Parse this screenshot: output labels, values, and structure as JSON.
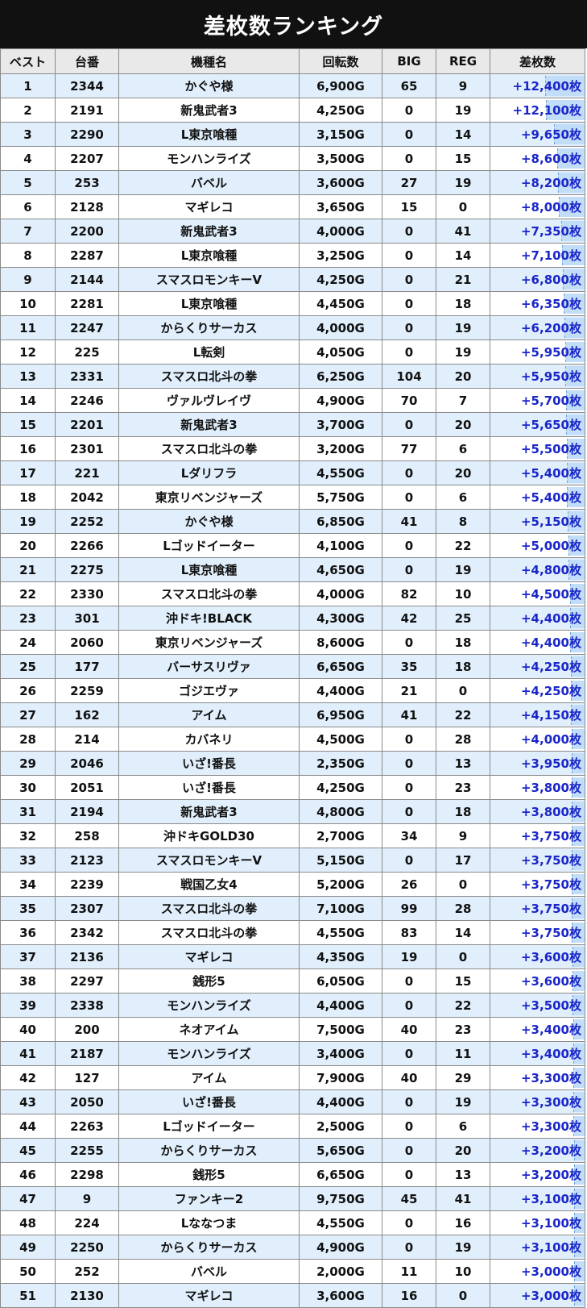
{
  "title": "差枚数ランキング",
  "headers": {
    "rank": "ベスト",
    "machine_no": "台番",
    "model": "機種名",
    "spins": "回転数",
    "big": "BIG",
    "reg": "REG",
    "diff": "差枚数"
  },
  "rows": [
    {
      "rank": "1",
      "machine_no": "2344",
      "model": "かぐや様",
      "spins": "6,900G",
      "big": "65",
      "reg": "9",
      "diff": "+12,400枚",
      "diff_value": 12400
    },
    {
      "rank": "2",
      "machine_no": "2191",
      "model": "新鬼武者3",
      "spins": "4,250G",
      "big": "0",
      "reg": "19",
      "diff": "+12,100枚",
      "diff_value": 12100
    },
    {
      "rank": "3",
      "machine_no": "2290",
      "model": "L東京喰種",
      "spins": "3,150G",
      "big": "0",
      "reg": "14",
      "diff": "+9,650枚",
      "diff_value": 9650
    },
    {
      "rank": "4",
      "machine_no": "2207",
      "model": "モンハンライズ",
      "spins": "3,500G",
      "big": "0",
      "reg": "15",
      "diff": "+8,600枚",
      "diff_value": 8600
    },
    {
      "rank": "5",
      "machine_no": "253",
      "model": "バベル",
      "spins": "3,600G",
      "big": "27",
      "reg": "19",
      "diff": "+8,200枚",
      "diff_value": 8200
    },
    {
      "rank": "6",
      "machine_no": "2128",
      "model": "マギレコ",
      "spins": "3,650G",
      "big": "15",
      "reg": "0",
      "diff": "+8,000枚",
      "diff_value": 8000
    },
    {
      "rank": "7",
      "machine_no": "2200",
      "model": "新鬼武者3",
      "spins": "4,000G",
      "big": "0",
      "reg": "41",
      "diff": "+7,350枚",
      "diff_value": 7350
    },
    {
      "rank": "8",
      "machine_no": "2287",
      "model": "L東京喰種",
      "spins": "3,250G",
      "big": "0",
      "reg": "14",
      "diff": "+7,100枚",
      "diff_value": 7100
    },
    {
      "rank": "9",
      "machine_no": "2144",
      "model": "スマスロモンキーV",
      "spins": "4,250G",
      "big": "0",
      "reg": "21",
      "diff": "+6,800枚",
      "diff_value": 6800
    },
    {
      "rank": "10",
      "machine_no": "2281",
      "model": "L東京喰種",
      "spins": "4,450G",
      "big": "0",
      "reg": "18",
      "diff": "+6,350枚",
      "diff_value": 6350
    },
    {
      "rank": "11",
      "machine_no": "2247",
      "model": "からくりサーカス",
      "spins": "4,000G",
      "big": "0",
      "reg": "19",
      "diff": "+6,200枚",
      "diff_value": 6200
    },
    {
      "rank": "12",
      "machine_no": "225",
      "model": "L転剣",
      "spins": "4,050G",
      "big": "0",
      "reg": "19",
      "diff": "+5,950枚",
      "diff_value": 5950
    },
    {
      "rank": "13",
      "machine_no": "2331",
      "model": "スマスロ北斗の拳",
      "spins": "6,250G",
      "big": "104",
      "reg": "20",
      "diff": "+5,950枚",
      "diff_value": 5950
    },
    {
      "rank": "14",
      "machine_no": "2246",
      "model": "ヴァルヴレイヴ",
      "spins": "4,900G",
      "big": "70",
      "reg": "7",
      "diff": "+5,700枚",
      "diff_value": 5700
    },
    {
      "rank": "15",
      "machine_no": "2201",
      "model": "新鬼武者3",
      "spins": "3,700G",
      "big": "0",
      "reg": "20",
      "diff": "+5,650枚",
      "diff_value": 5650
    },
    {
      "rank": "16",
      "machine_no": "2301",
      "model": "スマスロ北斗の拳",
      "spins": "3,200G",
      "big": "77",
      "reg": "6",
      "diff": "+5,500枚",
      "diff_value": 5500
    },
    {
      "rank": "17",
      "machine_no": "221",
      "model": "Lダリフラ",
      "spins": "4,550G",
      "big": "0",
      "reg": "20",
      "diff": "+5,400枚",
      "diff_value": 5400
    },
    {
      "rank": "18",
      "machine_no": "2042",
      "model": "東京リベンジャーズ",
      "spins": "5,750G",
      "big": "0",
      "reg": "6",
      "diff": "+5,400枚",
      "diff_value": 5400
    },
    {
      "rank": "19",
      "machine_no": "2252",
      "model": "かぐや様",
      "spins": "6,850G",
      "big": "41",
      "reg": "8",
      "diff": "+5,150枚",
      "diff_value": 5150
    },
    {
      "rank": "20",
      "machine_no": "2266",
      "model": "Lゴッドイーター",
      "spins": "4,100G",
      "big": "0",
      "reg": "22",
      "diff": "+5,000枚",
      "diff_value": 5000
    },
    {
      "rank": "21",
      "machine_no": "2275",
      "model": "L東京喰種",
      "spins": "4,650G",
      "big": "0",
      "reg": "19",
      "diff": "+4,800枚",
      "diff_value": 4800
    },
    {
      "rank": "22",
      "machine_no": "2330",
      "model": "スマスロ北斗の拳",
      "spins": "4,000G",
      "big": "82",
      "reg": "10",
      "diff": "+4,500枚",
      "diff_value": 4500
    },
    {
      "rank": "23",
      "machine_no": "301",
      "model": "沖ドキ!BLACK",
      "spins": "4,300G",
      "big": "42",
      "reg": "25",
      "diff": "+4,400枚",
      "diff_value": 4400
    },
    {
      "rank": "24",
      "machine_no": "2060",
      "model": "東京リベンジャーズ",
      "spins": "8,600G",
      "big": "0",
      "reg": "18",
      "diff": "+4,400枚",
      "diff_value": 4400
    },
    {
      "rank": "25",
      "machine_no": "177",
      "model": "バーサスリヴァ",
      "spins": "6,650G",
      "big": "35",
      "reg": "18",
      "diff": "+4,250枚",
      "diff_value": 4250
    },
    {
      "rank": "26",
      "machine_no": "2259",
      "model": "ゴジエヴァ",
      "spins": "4,400G",
      "big": "21",
      "reg": "0",
      "diff": "+4,250枚",
      "diff_value": 4250
    },
    {
      "rank": "27",
      "machine_no": "162",
      "model": "アイム",
      "spins": "6,950G",
      "big": "41",
      "reg": "22",
      "diff": "+4,150枚",
      "diff_value": 4150
    },
    {
      "rank": "28",
      "machine_no": "214",
      "model": "カバネリ",
      "spins": "4,500G",
      "big": "0",
      "reg": "28",
      "diff": "+4,000枚",
      "diff_value": 4000
    },
    {
      "rank": "29",
      "machine_no": "2046",
      "model": "いざ!番長",
      "spins": "2,350G",
      "big": "0",
      "reg": "13",
      "diff": "+3,950枚",
      "diff_value": 3950
    },
    {
      "rank": "30",
      "machine_no": "2051",
      "model": "いざ!番長",
      "spins": "4,250G",
      "big": "0",
      "reg": "23",
      "diff": "+3,800枚",
      "diff_value": 3800
    },
    {
      "rank": "31",
      "machine_no": "2194",
      "model": "新鬼武者3",
      "spins": "4,800G",
      "big": "0",
      "reg": "18",
      "diff": "+3,800枚",
      "diff_value": 3800
    },
    {
      "rank": "32",
      "machine_no": "258",
      "model": "沖ドキGOLD30",
      "spins": "2,700G",
      "big": "34",
      "reg": "9",
      "diff": "+3,750枚",
      "diff_value": 3750
    },
    {
      "rank": "33",
      "machine_no": "2123",
      "model": "スマスロモンキーV",
      "spins": "5,150G",
      "big": "0",
      "reg": "17",
      "diff": "+3,750枚",
      "diff_value": 3750
    },
    {
      "rank": "34",
      "machine_no": "2239",
      "model": "戦国乙女4",
      "spins": "5,200G",
      "big": "26",
      "reg": "0",
      "diff": "+3,750枚",
      "diff_value": 3750
    },
    {
      "rank": "35",
      "machine_no": "2307",
      "model": "スマスロ北斗の拳",
      "spins": "7,100G",
      "big": "99",
      "reg": "28",
      "diff": "+3,750枚",
      "diff_value": 3750
    },
    {
      "rank": "36",
      "machine_no": "2342",
      "model": "スマスロ北斗の拳",
      "spins": "4,550G",
      "big": "83",
      "reg": "14",
      "diff": "+3,750枚",
      "diff_value": 3750
    },
    {
      "rank": "37",
      "machine_no": "2136",
      "model": "マギレコ",
      "spins": "4,350G",
      "big": "19",
      "reg": "0",
      "diff": "+3,600枚",
      "diff_value": 3600
    },
    {
      "rank": "38",
      "machine_no": "2297",
      "model": "銭形5",
      "spins": "6,050G",
      "big": "0",
      "reg": "15",
      "diff": "+3,600枚",
      "diff_value": 3600
    },
    {
      "rank": "39",
      "machine_no": "2338",
      "model": "モンハンライズ",
      "spins": "4,400G",
      "big": "0",
      "reg": "22",
      "diff": "+3,500枚",
      "diff_value": 3500
    },
    {
      "rank": "40",
      "machine_no": "200",
      "model": "ネオアイム",
      "spins": "7,500G",
      "big": "40",
      "reg": "23",
      "diff": "+3,400枚",
      "diff_value": 3400
    },
    {
      "rank": "41",
      "machine_no": "2187",
      "model": "モンハンライズ",
      "spins": "3,400G",
      "big": "0",
      "reg": "11",
      "diff": "+3,400枚",
      "diff_value": 3400
    },
    {
      "rank": "42",
      "machine_no": "127",
      "model": "アイム",
      "spins": "7,900G",
      "big": "40",
      "reg": "29",
      "diff": "+3,300枚",
      "diff_value": 3300
    },
    {
      "rank": "43",
      "machine_no": "2050",
      "model": "いざ!番長",
      "spins": "4,400G",
      "big": "0",
      "reg": "19",
      "diff": "+3,300枚",
      "diff_value": 3300
    },
    {
      "rank": "44",
      "machine_no": "2263",
      "model": "Lゴッドイーター",
      "spins": "2,500G",
      "big": "0",
      "reg": "6",
      "diff": "+3,300枚",
      "diff_value": 3300
    },
    {
      "rank": "45",
      "machine_no": "2255",
      "model": "からくりサーカス",
      "spins": "5,650G",
      "big": "0",
      "reg": "20",
      "diff": "+3,200枚",
      "diff_value": 3200
    },
    {
      "rank": "46",
      "machine_no": "2298",
      "model": "銭形5",
      "spins": "6,650G",
      "big": "0",
      "reg": "13",
      "diff": "+3,200枚",
      "diff_value": 3200
    },
    {
      "rank": "47",
      "machine_no": "9",
      "model": "ファンキー2",
      "spins": "9,750G",
      "big": "45",
      "reg": "41",
      "diff": "+3,100枚",
      "diff_value": 3100
    },
    {
      "rank": "48",
      "machine_no": "224",
      "model": "Lななつま",
      "spins": "4,550G",
      "big": "0",
      "reg": "16",
      "diff": "+3,100枚",
      "diff_value": 3100
    },
    {
      "rank": "49",
      "machine_no": "2250",
      "model": "からくりサーカス",
      "spins": "4,900G",
      "big": "0",
      "reg": "19",
      "diff": "+3,100枚",
      "diff_value": 3100
    },
    {
      "rank": "50",
      "machine_no": "252",
      "model": "バベル",
      "spins": "2,000G",
      "big": "11",
      "reg": "10",
      "diff": "+3,000枚",
      "diff_value": 3000
    },
    {
      "rank": "51",
      "machine_no": "2130",
      "model": "マギレコ",
      "spins": "3,600G",
      "big": "16",
      "reg": "0",
      "diff": "+3,000枚",
      "diff_value": 3000
    }
  ],
  "colors": {
    "title_bg": "#111111",
    "title_text": "#ffffff",
    "header_bg": "#e9e9e9",
    "row_stripe": "#e1effc",
    "diff_text": "#1a26c8",
    "diff_bar": "#c2ddf7"
  }
}
